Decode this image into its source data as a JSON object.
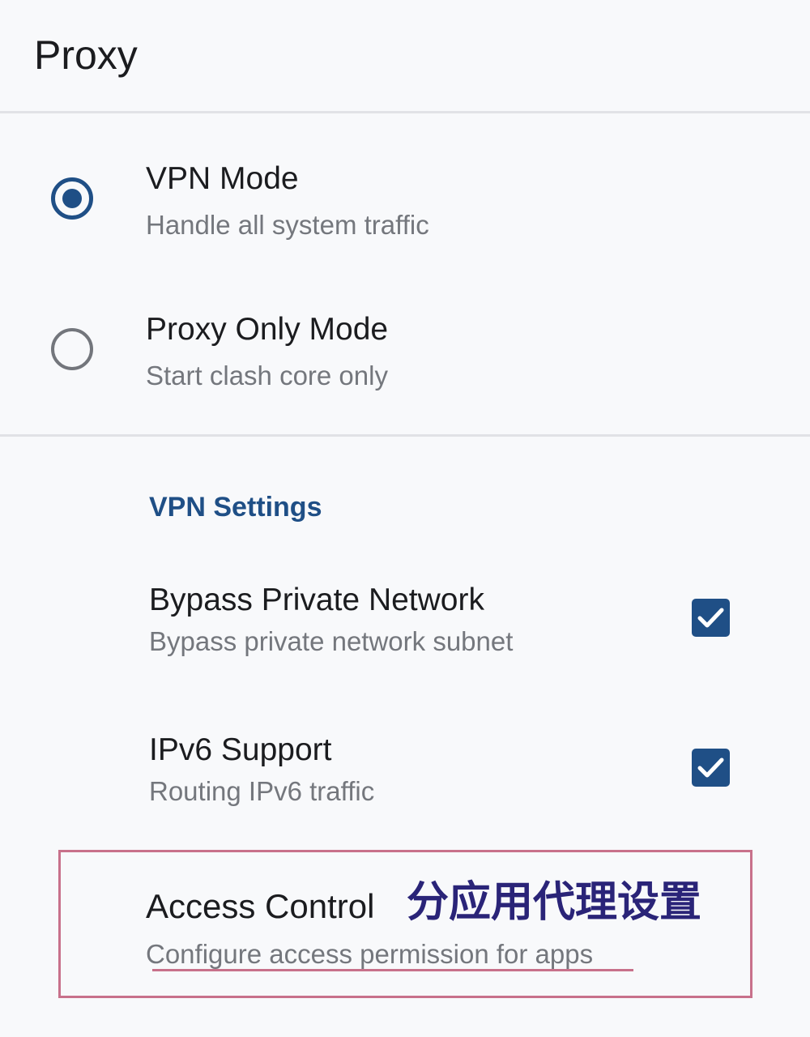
{
  "app_bar": {
    "title": "Proxy"
  },
  "modes": [
    {
      "title": "VPN Mode",
      "subtitle": "Handle all system traffic",
      "selected": true
    },
    {
      "title": "Proxy Only Mode",
      "subtitle": "Start clash core only",
      "selected": false
    }
  ],
  "vpn_settings": {
    "header": "VPN Settings",
    "items": [
      {
        "title": "Bypass Private Network",
        "subtitle": "Bypass private network subnet",
        "checked": true
      },
      {
        "title": "IPv6 Support",
        "subtitle": "Routing IPv6 traffic",
        "checked": true
      },
      {
        "title": "Access Control",
        "subtitle": "Configure access permission for apps"
      }
    ]
  },
  "annotation": {
    "text": "分应用代理设置",
    "color": "#2a2478",
    "highlight_color": "#c8718b"
  },
  "colors": {
    "accent": "#1f4f86",
    "background": "#f8f9fb",
    "divider": "#e1e2e6",
    "secondary_text": "#74777d"
  }
}
